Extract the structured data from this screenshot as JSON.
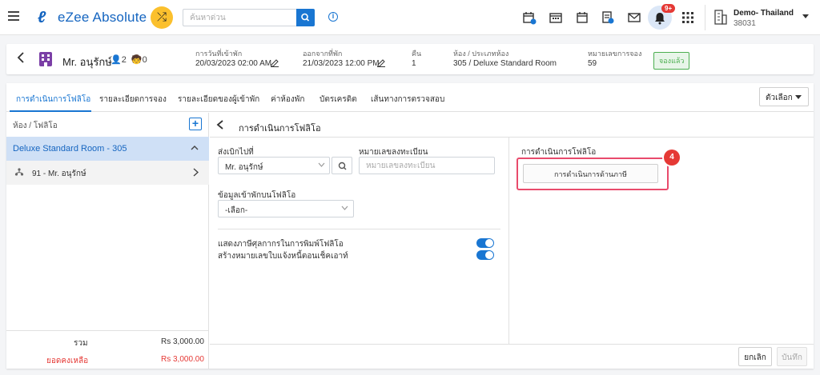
{
  "topbar": {
    "app_name": "eZee Absolute",
    "search_placeholder": "ค้นหาด่วน",
    "notification_badge": "9+",
    "hotel_name": "Demo- Thailand",
    "hotel_code": "38031",
    "icons": [
      "menu-icon",
      "shuffle-icon",
      "search-icon",
      "info-icon",
      "calendar-add-icon",
      "calendar-icon",
      "calendar-week-icon",
      "document-icon",
      "mail-icon",
      "bell-icon",
      "apps-grid-icon",
      "building-icon"
    ]
  },
  "guest": {
    "name": "Mr. อนุรักษ์",
    "adults": "2",
    "children": "0",
    "arrival_label": "การวันที่เข้าพัก",
    "arrival_value": "20/03/2023 02:00 AM",
    "departure_label": "ออกจากที่พัก",
    "departure_value": "21/03/2023 12:00 PM",
    "nights_label": "คืน",
    "nights_value": "1",
    "room_label": "ห้อง / ประเภทห้อง",
    "room_value": "305 / Deluxe Standard Room",
    "res_no_label": "หมายเลขการจอง",
    "res_no_value": "59",
    "status": "จองแล้ว"
  },
  "tabs": [
    {
      "label": "การดำเนินการโฟลิโอ",
      "active": true
    },
    {
      "label": "รายละเอียดการจอง"
    },
    {
      "label": "รายละเอียดของผู้เข้าพัก"
    },
    {
      "label": "ค่าห้องพัก"
    },
    {
      "label": "บัตรเครดิต"
    },
    {
      "label": "เส้นทางการตรวจสอบ"
    }
  ],
  "options_label": "ตัวเลือก",
  "left_panel": {
    "header": "ห้อง / โฟลิโอ",
    "room_item": "Deluxe Standard Room - 305",
    "folio_item": "91 - Mr. อนุรักษ์",
    "total_label": "รวม",
    "total_value": "Rs 3,000.00",
    "balance_label": "ยอดคงเหลือ",
    "balance_value": "Rs 3,000.00"
  },
  "section": {
    "title": "การดำเนินการโฟลิโอ",
    "send_to_label": "ส่งเบิกไปที่",
    "send_to_value": "Mr. อนุรักษ์",
    "reg_no_label": "หมายเลขลงทะเบียน",
    "reg_no_placeholder": "หมายเลขลงทะเบียน",
    "guest_info_label": "ข้อมูลเข้าพักบนโฟลิโอ",
    "guest_info_value": "-เลือก-",
    "toggle1_label": "แสดงภาษีศุลกากรในการพิมพ์โฟลิโอ",
    "toggle1_on": true,
    "toggle2_label": "สร้างหมายเลขใบแจ้งหนี้ตอนเช็คเอาท์",
    "toggle2_on": true
  },
  "right_panel": {
    "title": "การดำเนินการโฟลิโอ",
    "tax_button": "การดำเนินการด้านภาษี",
    "step_number": "4"
  },
  "actions": {
    "cancel": "ยกเลิก",
    "save": "บันทึก"
  },
  "colors": {
    "accent": "#1976d2",
    "highlight": "#e94b6c",
    "step_badge": "#e53935",
    "status_green": "#4caf50",
    "selected_row": "#cfe0f6"
  }
}
